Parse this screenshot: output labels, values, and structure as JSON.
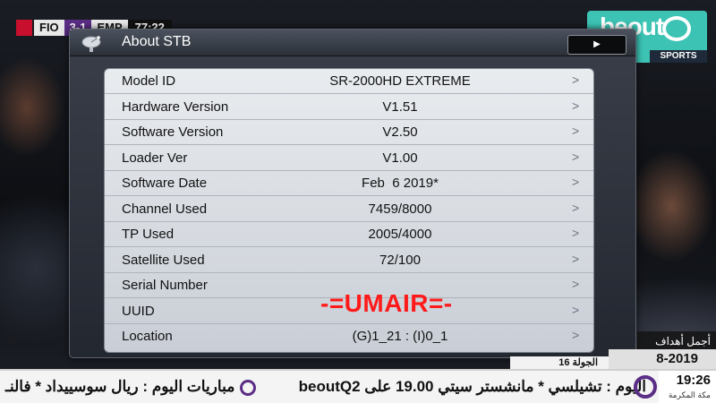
{
  "broadcast": {
    "scoreboard": {
      "team1": "FIO",
      "score": "3-1",
      "team2": "EMP",
      "time": "77:22"
    },
    "channel_logo": {
      "main": "beout",
      "sub": "SPORTS"
    },
    "captions": {
      "arabic_title": "أجمل أهداف الدوري",
      "year": "8-2019",
      "round": "الجولة 16"
    },
    "ticker": {
      "main_text": "اليوم : تشيلسي * مانشستر سيتي 19.00 على beoutQ2",
      "left_text": "مباريات اليوم : ريال سوسييداد * فالنـ",
      "clock_time": "19:26",
      "clock_sub": "مكة المكرمة"
    }
  },
  "dialog": {
    "title": "About STB",
    "header_icon": "satellite-dish-icon",
    "play_button_label": "▶",
    "rows": [
      {
        "label": "Model ID",
        "value": "SR-2000HD EXTREME"
      },
      {
        "label": "Hardware Version",
        "value": "V1.51"
      },
      {
        "label": "Software Version",
        "value": "V2.50"
      },
      {
        "label": "Loader Ver",
        "value": "V1.00"
      },
      {
        "label": "Software Date",
        "value": "Feb  6 2019*"
      },
      {
        "label": "Channel Used",
        "value": "7459/8000"
      },
      {
        "label": "TP Used",
        "value": "2005/4000"
      },
      {
        "label": "Satellite Used",
        "value": "72/100"
      },
      {
        "label": "Serial Number",
        "value": ""
      },
      {
        "label": "UUID",
        "value": ""
      },
      {
        "label": "Location",
        "value": "(G)1_21 : (I)0_1"
      }
    ],
    "row_arrow": ">",
    "watermark": "-=UMAIR=-"
  },
  "colors": {
    "watermark": "#ff1a1a",
    "brand": "#3cc3b4",
    "score_accent": "#5b2d86"
  }
}
